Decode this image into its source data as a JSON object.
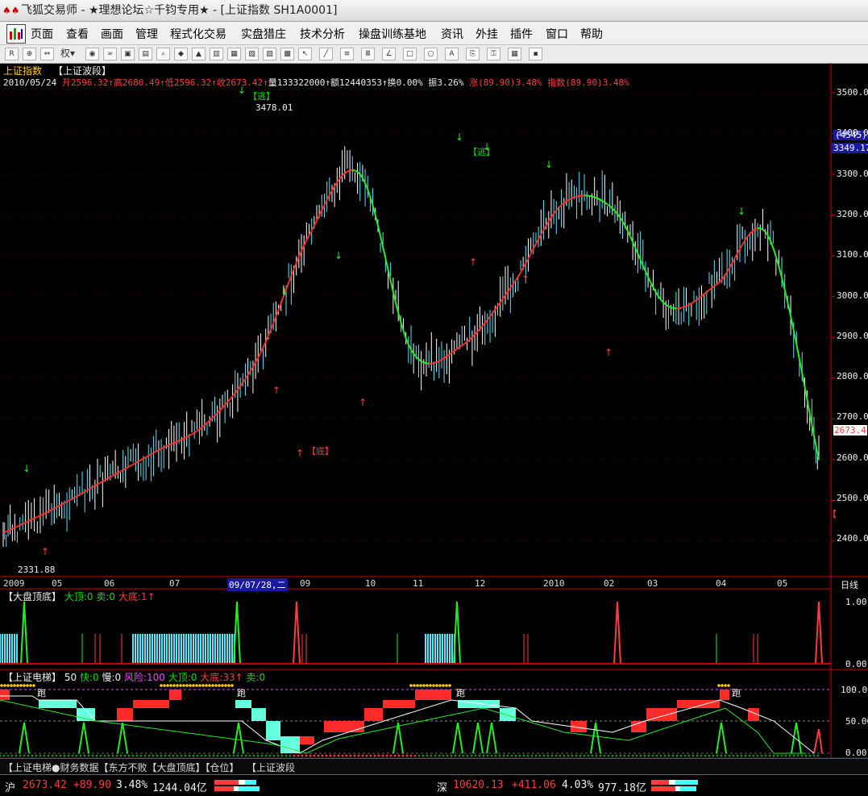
{
  "window": {
    "title": "飞狐交易师 - ★理想论坛☆千钧专用★ - [上证指数 SH1A0001]"
  },
  "menu": [
    "页面",
    "查看",
    "画面",
    "管理",
    "程式化交易",
    "实盘猎庄",
    "技术分析",
    "操盘训练基地",
    "资讯",
    "外挂",
    "插件",
    "窗口",
    "帮助"
  ],
  "toolbar": {
    "icons": [
      "rsi-icon",
      "zoom-in-icon",
      "scroll-icon",
      "rights-icon",
      "binocular-icon",
      "glasses-icon",
      "stock-icon",
      "book-icon",
      "search-icon",
      "alarm-icon",
      "bell-icon",
      "layout-icon",
      "layout2-icon",
      "layout3-icon",
      "layout4-icon",
      "layout5-icon",
      "cursor-icon",
      "line-icon",
      "channel-icon",
      "fib-icon",
      "gann-icon",
      "rect-icon",
      "circle-icon",
      "text-icon",
      "copy-icon",
      "lock-icon",
      "palette-icon",
      "save-icon"
    ],
    "rights_label": "权"
  },
  "main": {
    "name": "上证指数",
    "indicator": "【上证波段】",
    "info": {
      "date": "2010/05/24",
      "open": "2596.32",
      "high": "2680.49",
      "low": "2596.32",
      "close": "2673.42",
      "vol": "133322000",
      "amount": "12440353",
      "turnover": "0.00%",
      "amplitude": "3.26%",
      "change": "涨(89.90)3.48%",
      "index": "指数(89.90)3.48%"
    },
    "labels": {
      "open": "开",
      "high": "高",
      "low": "低",
      "close": "收",
      "vol": "量",
      "amount": "额",
      "turnover": "换",
      "amplitude": "振"
    },
    "annotations": {
      "high_value": "3478.01",
      "low_value": "2331.88",
      "escape": "【逃】",
      "bottom": "【底】",
      "right_tag": "【"
    },
    "price_ticks": [
      "3500.0",
      "3400.0",
      "3300.0",
      "3200.0",
      "3100.0",
      "3000.0",
      "2900.0",
      "2800.0",
      "2700.0",
      "2600.0",
      "2500.0",
      "2400.0"
    ],
    "right_info": {
      "count": "(4545)",
      "price": "3349.17",
      "last": "2673.4"
    },
    "date_axis": [
      "2009",
      "05",
      "06",
      "07",
      "09/07/28,二",
      "09",
      "10",
      "11",
      "12",
      "2010",
      "02",
      "03",
      "04",
      "05"
    ],
    "period": "日线"
  },
  "panel1": {
    "name": "【大盘顶底】",
    "top_label": "大顶:0",
    "sell_label": "卖:0",
    "bottom_label": "大底:1",
    "ticks": [
      "1.00",
      "0.00"
    ]
  },
  "panel2": {
    "name": "【上证电梯】",
    "param": "50",
    "fast": "快:0",
    "slow": "慢:0",
    "risk": "风险:100",
    "top": "大顶:0",
    "bottom": "大底:33",
    "sell": "卖:0",
    "ticks": [
      "100.00",
      "50.00",
      "0.00"
    ],
    "run_label": "跑"
  },
  "tabs": [
    "【上证电梯●财务数据【东方不败【大盘顶底】【仓位】",
    "【上证波段"
  ],
  "status": {
    "sh": {
      "label": "沪",
      "price": "2673.42",
      "change": "+89.90",
      "pct": "3.48%",
      "amount": "1244.04亿"
    },
    "sz": {
      "label": "深",
      "price": "10620.13",
      "change": "+411.06",
      "pct": "4.03%",
      "amount": "977.18亿"
    }
  },
  "chart_data": {
    "type": "line",
    "x": [
      "2009-01",
      "2009-02",
      "2009-03",
      "2009-04",
      "2009-05",
      "2009-06",
      "2009-07",
      "2009-08",
      "2009-09",
      "2009-10",
      "2009-11",
      "2009-12",
      "2010-01",
      "2010-02",
      "2010-03",
      "2010-04",
      "2010-05"
    ],
    "series": [
      {
        "name": "上证波段",
        "values": [
          2420,
          2480,
          2550,
          2620,
          2690,
          2850,
          3150,
          3300,
          2870,
          2880,
          3030,
          3230,
          3210,
          2980,
          3030,
          3150,
          2600
        ]
      }
    ],
    "ylim": [
      2300,
      3550
    ],
    "colors": {
      "up": "#ff2a2a",
      "down": "#22ee22",
      "bar": "#52e8ff"
    }
  }
}
